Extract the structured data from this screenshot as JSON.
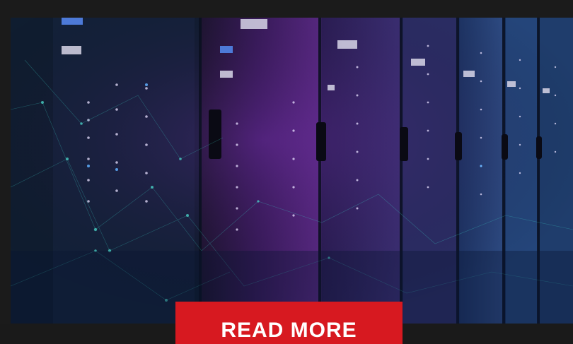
{
  "hero": {
    "image_name": "server-room-image",
    "theme_colors": [
      "#0b1a2e",
      "#361e5c",
      "#16325e"
    ]
  },
  "cta": {
    "label": "READ MORE",
    "color": "#d71920"
  }
}
